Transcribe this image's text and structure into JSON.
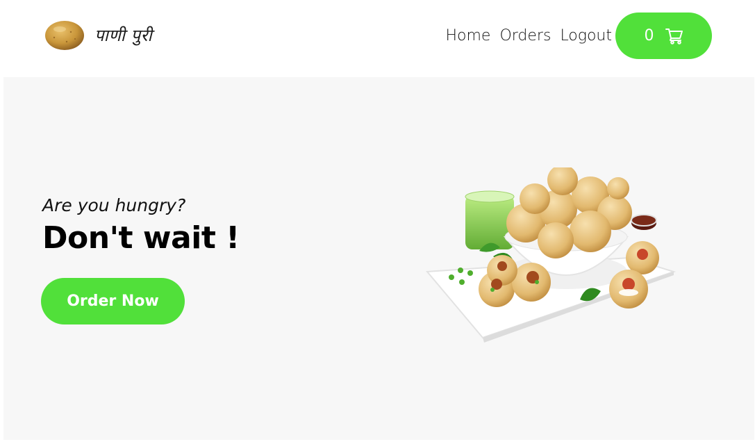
{
  "navbar": {
    "brand_text": "पाणी पुरी",
    "links": [
      {
        "label": "Home"
      },
      {
        "label": "Orders"
      },
      {
        "label": "Logout"
      }
    ],
    "cart": {
      "count": "0",
      "icon": "shopping-cart-icon"
    }
  },
  "hero": {
    "subtitle": "Are you hungry?",
    "title": "Don't wait !",
    "cta_label": "Order Now",
    "image": "pani-puri-platter"
  },
  "colors": {
    "accent": "#51e03a",
    "hero_bg": "#f7f7f7",
    "text": "#111111"
  }
}
